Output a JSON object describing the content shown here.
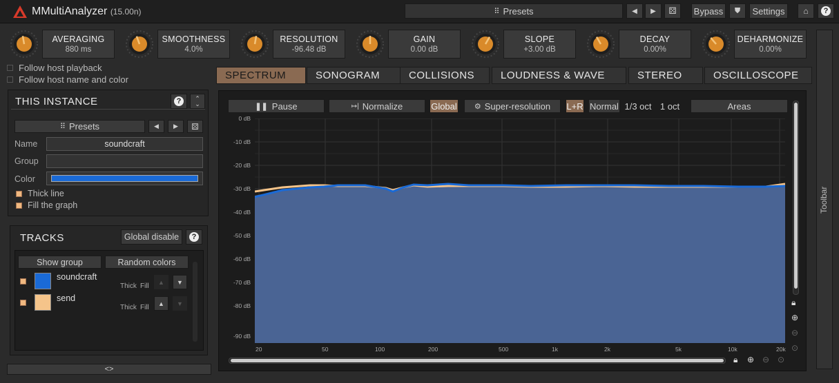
{
  "title": {
    "app": "MMultiAnalyzer",
    "version": "(15.00n)"
  },
  "topbar": {
    "presets": "Presets",
    "bypass": "Bypass",
    "settings": "Settings"
  },
  "knobs": [
    {
      "name": "AVERAGING",
      "value": "880 ms"
    },
    {
      "name": "SMOOTHNESS",
      "value": "4.0%"
    },
    {
      "name": "RESOLUTION",
      "value": "-96.48 dB"
    },
    {
      "name": "GAIN",
      "value": "0.00 dB"
    },
    {
      "name": "SLOPE",
      "value": "+3.00 dB"
    },
    {
      "name": "DECAY",
      "value": "0.00%"
    },
    {
      "name": "DEHARMONIZE",
      "value": "0.00%"
    }
  ],
  "options": {
    "follow_playback": "Follow host playback",
    "follow_name": "Follow host name and color"
  },
  "tabs": [
    "SPECTRUM",
    "SONOGRAM",
    "COLLISIONS",
    "LOUDNESS & WAVE",
    "STEREO",
    "OSCILLOSCOPE"
  ],
  "instance": {
    "title": "THIS INSTANCE",
    "presets": "Presets",
    "name_label": "Name",
    "name_value": "soundcraft",
    "group_label": "Group",
    "group_value": "",
    "color_label": "Color",
    "color": "#1a6ad6",
    "thick_line": "Thick line",
    "fill_graph": "Fill the graph"
  },
  "tracks": {
    "title": "TRACKS",
    "global_disable": "Global disable",
    "show_group": "Show group",
    "random_colors": "Random colors",
    "items": [
      {
        "name": "soundcraft",
        "color": "#1a6ad6",
        "thick": "Thick",
        "fill": "Fill"
      },
      {
        "name": "send",
        "color": "#f5c48a",
        "thick": "Thick",
        "fill": "Fill"
      }
    ]
  },
  "graph": {
    "pause": "Pause",
    "normalize": "Normalize",
    "global": "Global",
    "super_res": "Super-resolution",
    "lr": "L+R",
    "normal": "Normal",
    "oct_third": "1/3 oct",
    "oct_one": "1 oct",
    "areas": "Areas",
    "y_labels": [
      "0 dB",
      "-10 dB",
      "-20 dB",
      "-30 dB",
      "-40 dB",
      "-50 dB",
      "-60 dB",
      "-70 dB",
      "-80 dB",
      "-90 dB"
    ],
    "x_labels": [
      "20",
      "50",
      "100",
      "200",
      "500",
      "1k",
      "2k",
      "5k",
      "10k",
      "20k"
    ]
  },
  "toolbar_label": "Toolbar",
  "collapse_label": "<>"
}
